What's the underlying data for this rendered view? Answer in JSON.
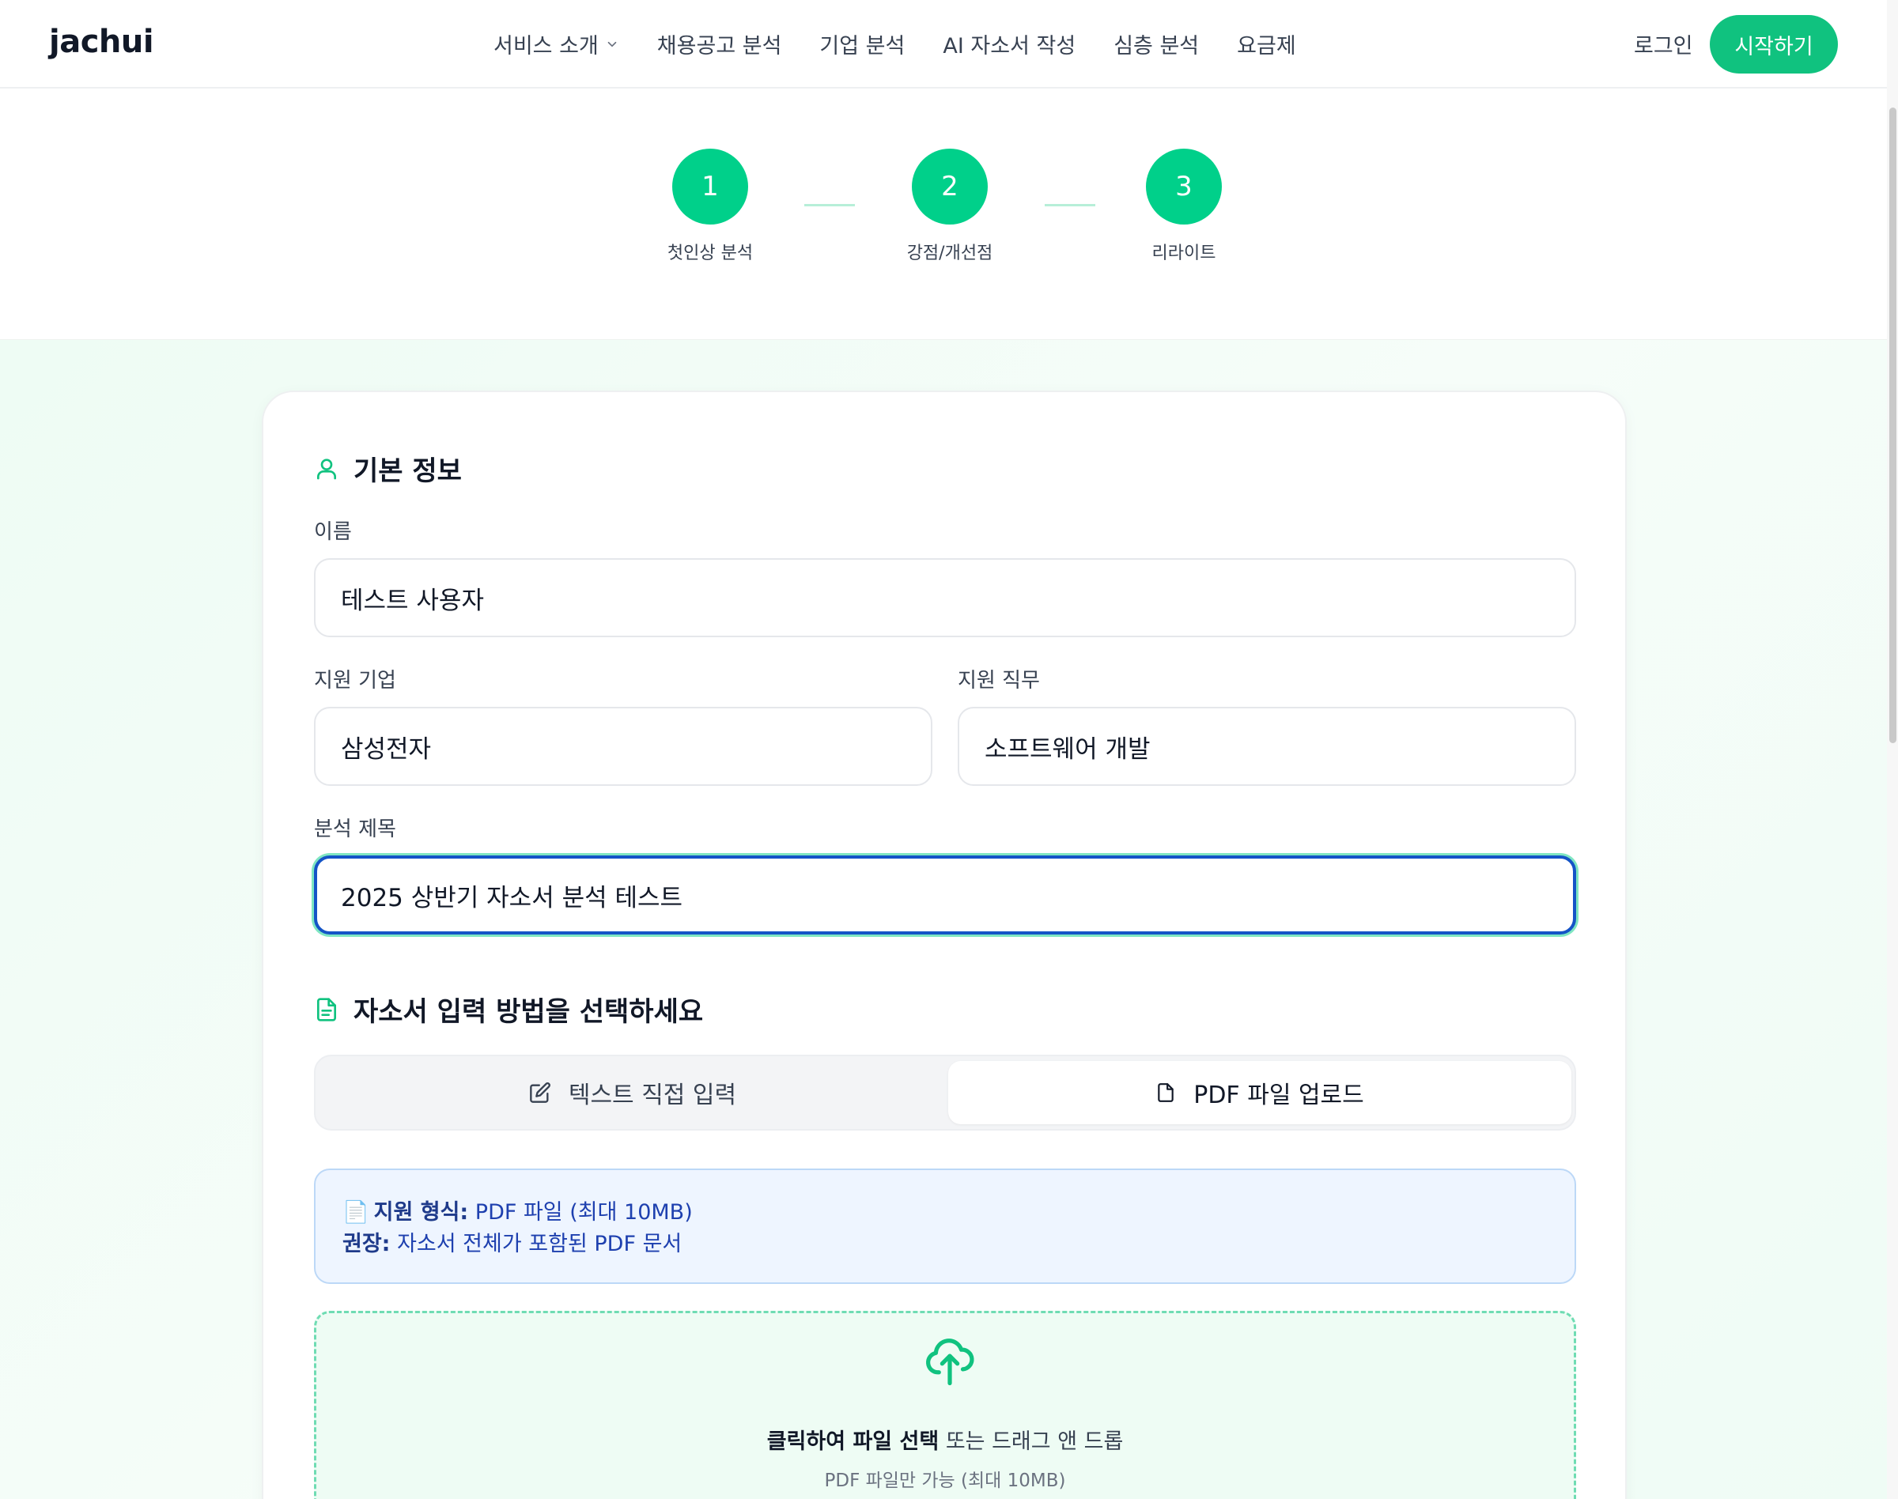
{
  "header": {
    "logo": "jachui",
    "nav": [
      "서비스 소개",
      "채용공고 분석",
      "기업 분석",
      "AI 자소서 작성",
      "심층 분석",
      "요금제"
    ],
    "login": "로그인",
    "start": "시작하기"
  },
  "steps": [
    {
      "number": "1",
      "label": "첫인상 분석"
    },
    {
      "number": "2",
      "label": "강점/개선점"
    },
    {
      "number": "3",
      "label": "리라이트"
    }
  ],
  "basic_info": {
    "title": "기본 정보",
    "name_label": "이름",
    "name_value": "테스트 사용자",
    "company_label": "지원 기업",
    "company_value": "삼성전자",
    "job_label": "지원 직무",
    "job_value": "소프트웨어 개발",
    "subject_label": "분석 제목",
    "subject_value": "2025 상반기 자소서 분석 테스트"
  },
  "input_method": {
    "title": "자소서 입력 방법을 선택하세요",
    "tab_text": "텍스트 직접 입력",
    "tab_pdf": "PDF 파일 업로드",
    "active_tab": "PDF 파일 업로드"
  },
  "info": {
    "format_label": "지원 형식:",
    "format_value": "PDF 파일 (최대 10MB)",
    "recommend_label": "권장:",
    "recommend_value": "자소서 전체가 포함된 PDF 문서"
  },
  "upload": {
    "main_bold": "클릭하여 파일 선택",
    "main_rest": "또는 드래그 앤 드롭",
    "sub": "PDF 파일만 가능 (최대 10MB)"
  },
  "colors": {
    "accent": "#10c27f",
    "step": "#00d08a",
    "focus": "#1454c7",
    "info_bg": "#eef5ff"
  },
  "icons": [
    "chevron-down-icon",
    "user-icon",
    "document-icon",
    "edit-icon",
    "file-icon",
    "cloud-upload-icon"
  ]
}
